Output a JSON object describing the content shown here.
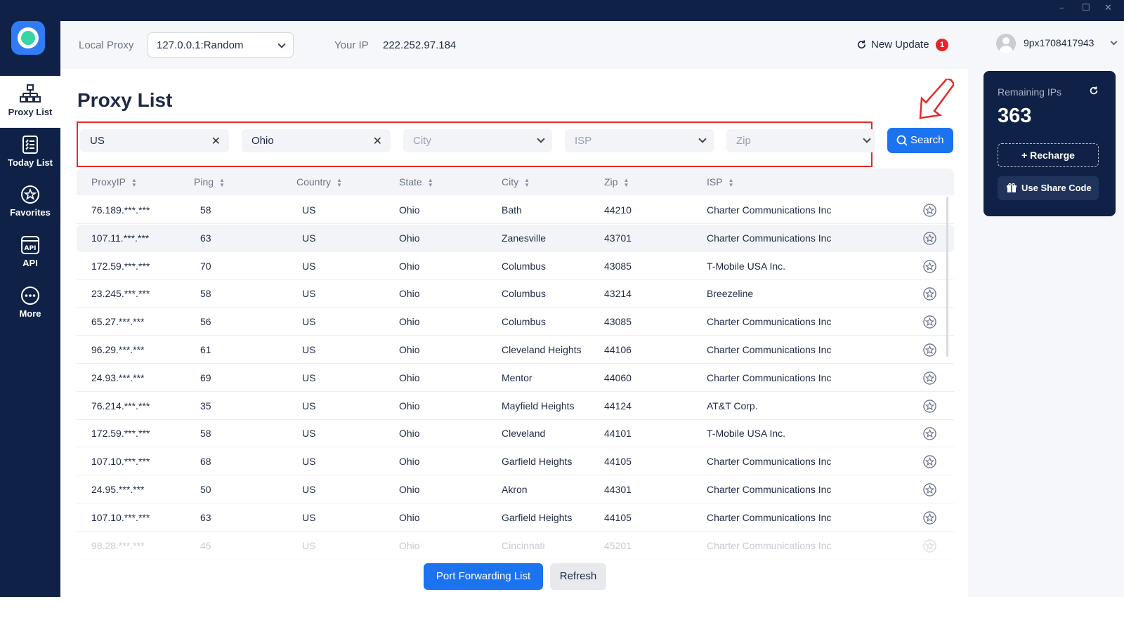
{
  "window": {
    "controls": [
      "–",
      "☐",
      "✕"
    ]
  },
  "sidebar": {
    "items": [
      {
        "label": "Proxy List",
        "icon": "network-icon"
      },
      {
        "label": "Today List",
        "icon": "clipboard-list-icon"
      },
      {
        "label": "Favorites",
        "icon": "star-icon"
      },
      {
        "label": "API",
        "icon": "api-icon"
      },
      {
        "label": "More",
        "icon": "more-dots-icon"
      }
    ]
  },
  "header": {
    "local_proxy_label": "Local Proxy",
    "local_proxy_value": "127.0.0.1:Random",
    "your_ip_label": "Your IP",
    "your_ip_value": "222.252.97.184",
    "update_label": "New Update",
    "update_badge": "1",
    "username": "9px1708417943"
  },
  "page": {
    "title": "Proxy List"
  },
  "filters": {
    "country": "US",
    "state": "Ohio",
    "city_placeholder": "City",
    "isp_placeholder": "ISP",
    "zip_placeholder": "Zip",
    "search_label": "Search"
  },
  "table": {
    "headers": [
      "ProxyIP",
      "Ping",
      "Country",
      "State",
      "City",
      "Zip",
      "ISP"
    ],
    "rows": [
      [
        "76.189.***.***",
        "58",
        "US",
        "Ohio",
        "Bath",
        "44210",
        "Charter Communications Inc"
      ],
      [
        "107.11.***.***",
        "63",
        "US",
        "Ohio",
        "Zanesville",
        "43701",
        "Charter Communications Inc"
      ],
      [
        "172.59.***.***",
        "70",
        "US",
        "Ohio",
        "Columbus",
        "43085",
        "T-Mobile USA Inc."
      ],
      [
        "23.245.***.***",
        "58",
        "US",
        "Ohio",
        "Columbus",
        "43214",
        "Breezeline"
      ],
      [
        "65.27.***.***",
        "56",
        "US",
        "Ohio",
        "Columbus",
        "43085",
        "Charter Communications Inc"
      ],
      [
        "96.29.***.***",
        "61",
        "US",
        "Ohio",
        "Cleveland Heights",
        "44106",
        "Charter Communications Inc"
      ],
      [
        "24.93.***.***",
        "69",
        "US",
        "Ohio",
        "Mentor",
        "44060",
        "Charter Communications Inc"
      ],
      [
        "76.214.***.***",
        "35",
        "US",
        "Ohio",
        "Mayfield Heights",
        "44124",
        "AT&T Corp."
      ],
      [
        "172.59.***.***",
        "58",
        "US",
        "Ohio",
        "Cleveland",
        "44101",
        "T-Mobile USA Inc."
      ],
      [
        "107.10.***.***",
        "68",
        "US",
        "Ohio",
        "Garfield Heights",
        "44105",
        "Charter Communications Inc"
      ],
      [
        "24.95.***.***",
        "50",
        "US",
        "Ohio",
        "Akron",
        "44301",
        "Charter Communications Inc"
      ],
      [
        "107.10.***.***",
        "63",
        "US",
        "Ohio",
        "Garfield Heights",
        "44105",
        "Charter Communications Inc"
      ],
      [
        "98.28.***.***",
        "45",
        "US",
        "Ohio",
        "Cincinnati",
        "45201",
        "Charter Communications Inc"
      ]
    ]
  },
  "footer": {
    "port_forwarding_label": "Port Forwarding List",
    "refresh_label": "Refresh"
  },
  "account_card": {
    "remaining_label": "Remaining IPs",
    "remaining_value": "363",
    "recharge_label": "+ Recharge",
    "share_code_label": "Use Share Code"
  },
  "colors": {
    "navy": "#0f2146",
    "accent": "#1b73f0",
    "highlight": "#e42a2a"
  }
}
